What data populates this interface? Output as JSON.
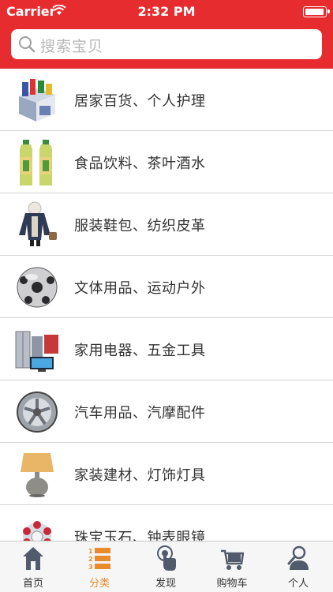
{
  "status_bar": {
    "carrier": "Carrier",
    "time": "2:32 PM"
  },
  "search": {
    "placeholder": "搜索宝贝"
  },
  "categories": [
    {
      "label": "居家百货、个人护理",
      "icon": "household-goods-icon"
    },
    {
      "label": "食品饮料、茶叶酒水",
      "icon": "drink-bottles-icon"
    },
    {
      "label": "服装鞋包、纺织皮革",
      "icon": "clothing-icon"
    },
    {
      "label": "文体用品、运动户外",
      "icon": "soccer-ball-icon"
    },
    {
      "label": "家用电器、五金工具",
      "icon": "appliances-icon"
    },
    {
      "label": "汽车用品、汽摩配件",
      "icon": "wheel-rim-icon"
    },
    {
      "label": "家装建材、灯饰灯具",
      "icon": "table-lamp-icon"
    },
    {
      "label": "珠宝玉石、钟表眼镜",
      "icon": "jewelry-icon"
    }
  ],
  "tabbar": {
    "home": "首页",
    "category": "分类",
    "discover": "发现",
    "cart": "购物车",
    "profile": "个人",
    "active": "category"
  },
  "colors": {
    "brand": "#e62c2f",
    "active_tab": "#e98a2d",
    "tab_icon": "#515b6b"
  }
}
